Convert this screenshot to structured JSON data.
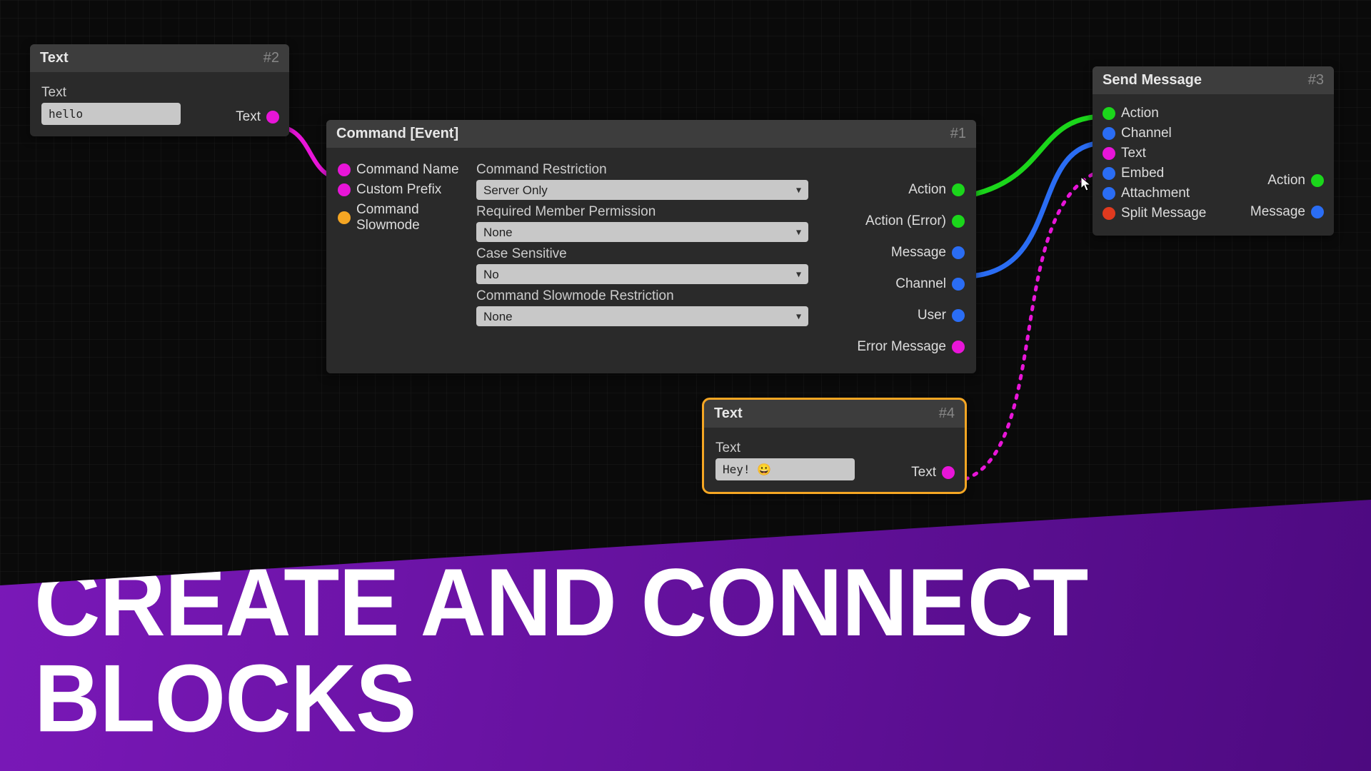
{
  "banner": {
    "headline": "CREATE AND CONNECT BLOCKS"
  },
  "nodes": {
    "n2": {
      "title": "Text",
      "id": "#2",
      "field_label": "Text",
      "value": "hello",
      "out_label": "Text"
    },
    "n1": {
      "title": "Command [Event]",
      "id": "#1",
      "inputs": {
        "command_name": "Command Name",
        "custom_prefix": "Custom Prefix",
        "command_slowmode": "Command Slowmode"
      },
      "fields": {
        "restriction_label": "Command Restriction",
        "restriction_value": "Server Only",
        "permission_label": "Required Member Permission",
        "permission_value": "None",
        "case_label": "Case Sensitive",
        "case_value": "No",
        "slowmode_label": "Command Slowmode Restriction",
        "slowmode_value": "None"
      },
      "outputs": {
        "action": "Action",
        "action_error": "Action (Error)",
        "message": "Message",
        "channel": "Channel",
        "user": "User",
        "error_message": "Error Message"
      }
    },
    "n4": {
      "title": "Text",
      "id": "#4",
      "field_label": "Text",
      "value": "Hey! 😀",
      "out_label": "Text"
    },
    "n3": {
      "title": "Send Message",
      "id": "#3",
      "inputs": {
        "action": "Action",
        "channel": "Channel",
        "text": "Text",
        "embed": "Embed",
        "attachment": "Attachment",
        "split_message": "Split Message"
      },
      "outputs": {
        "action": "Action",
        "message": "Message"
      }
    }
  }
}
